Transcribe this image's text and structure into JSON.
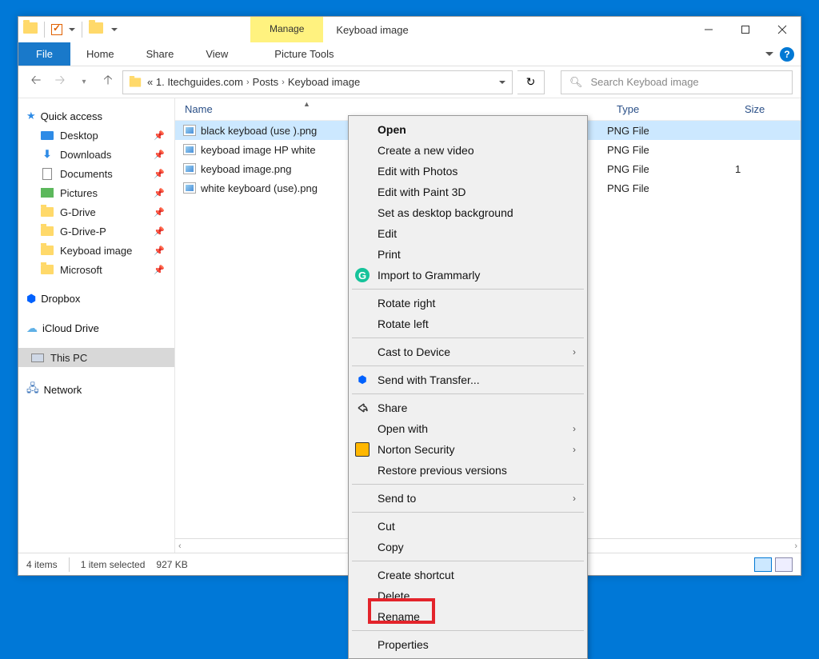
{
  "title": "Keyboad image",
  "contextual_tab": "Manage",
  "picture_tools": "Picture Tools",
  "ribbon": {
    "file": "File",
    "home": "Home",
    "share": "Share",
    "view": "View"
  },
  "breadcrumb": {
    "prefix": "«",
    "p1": "1. Itechguides.com",
    "p2": "Posts",
    "p3": "Keyboad image"
  },
  "search_placeholder": "Search Keyboad image",
  "nav": {
    "quick_access": "Quick access",
    "items": [
      {
        "label": "Desktop",
        "pin": true
      },
      {
        "label": "Downloads",
        "pin": true
      },
      {
        "label": "Documents",
        "pin": true
      },
      {
        "label": "Pictures",
        "pin": true
      },
      {
        "label": "G-Drive",
        "pin": true
      },
      {
        "label": "G-Drive-P",
        "pin": true
      },
      {
        "label": "Keyboad image",
        "pin": true
      },
      {
        "label": "Microsoft",
        "pin": true
      }
    ],
    "dropbox": "Dropbox",
    "icloud": "iCloud Drive",
    "this_pc": "This PC",
    "network": "Network"
  },
  "columns": {
    "name": "Name",
    "type": "Type",
    "size": "Size"
  },
  "files": [
    {
      "name": "black keyboad (use ).png",
      "type": "PNG File",
      "size": "",
      "selected": true
    },
    {
      "name": "keyboad image HP white",
      "type": "PNG File",
      "size": ""
    },
    {
      "name": "keyboad image.png",
      "type": "PNG File",
      "size": "1"
    },
    {
      "name": "white keyboard (use).png",
      "type": "PNG File",
      "size": ""
    }
  ],
  "status": {
    "count": "4 items",
    "selected": "1 item selected",
    "size": "927 KB"
  },
  "context_menu": {
    "open": "Open",
    "create_video": "Create a new video",
    "edit_photos": "Edit with Photos",
    "edit_paint3d": "Edit with Paint 3D",
    "set_bg": "Set as desktop background",
    "edit": "Edit",
    "print": "Print",
    "grammarly": "Import to Grammarly",
    "rotate_right": "Rotate right",
    "rotate_left": "Rotate left",
    "cast": "Cast to Device",
    "transfer": "Send with Transfer...",
    "share": "Share",
    "open_with": "Open with",
    "norton": "Norton Security",
    "restore": "Restore previous versions",
    "send_to": "Send to",
    "cut": "Cut",
    "copy": "Copy",
    "shortcut": "Create shortcut",
    "delete": "Delete",
    "rename": "Rename",
    "properties": "Properties"
  }
}
